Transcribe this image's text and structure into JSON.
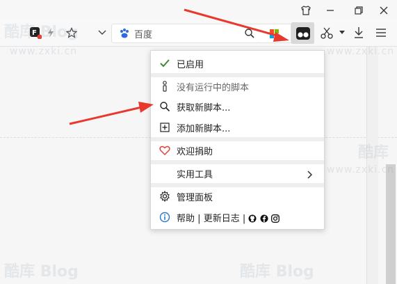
{
  "browser": {
    "url_placeholder": "百度",
    "watermark_brand": "酷库",
    "watermark_blog": "Blog",
    "watermark_url": "www.zxki.cn"
  },
  "menu": {
    "enabled_label": "已启用",
    "no_scripts_label": "没有运行中的脚本",
    "get_new_label": "获取新脚本...",
    "add_new_label": "添加新脚本...",
    "donate_label": "欢迎捐助",
    "utilities_label": "实用工具",
    "dashboard_label": "管理面板",
    "help_label": "帮助",
    "changelog_label": "更新日志",
    "divider": "|"
  },
  "colors": {
    "check": "#3b8b3b",
    "heart": "#e0443a",
    "info": "#2a7bc4",
    "arrow": "#e8392f",
    "baidu": "#2f6bdc"
  }
}
